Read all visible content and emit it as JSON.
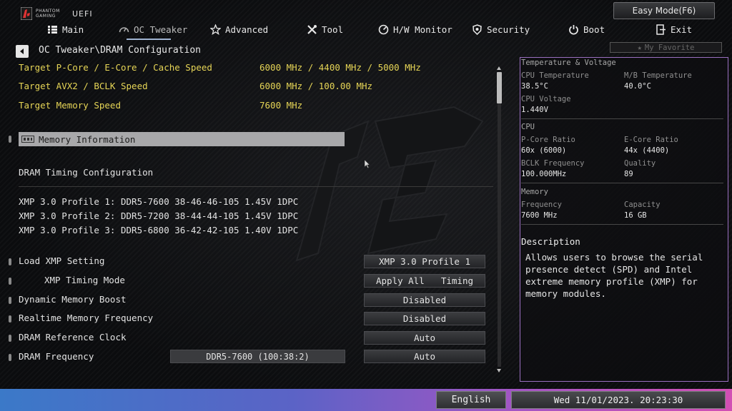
{
  "brand": {
    "line1": "PHANTOM",
    "line2": "GAMING",
    "uefi": "UEFI"
  },
  "header": {
    "easy_mode_label": "Easy Mode(F6)"
  },
  "nav": {
    "items": [
      {
        "label": "Main",
        "icon": "list-icon"
      },
      {
        "label": "OC Tweaker",
        "icon": "speedometer-icon"
      },
      {
        "label": "Advanced",
        "icon": "star-icon"
      },
      {
        "label": "Tool",
        "icon": "wrench-icon"
      },
      {
        "label": "H/W Monitor",
        "icon": "gauge-icon"
      },
      {
        "label": "Security",
        "icon": "shield-icon"
      },
      {
        "label": "Boot",
        "icon": "power-icon"
      },
      {
        "label": "Exit",
        "icon": "exit-icon"
      }
    ],
    "active": "OC Tweaker"
  },
  "breadcrumb": "OC Tweaker\\DRAM Configuration",
  "favorite_label": "My Favorite",
  "targets": [
    {
      "label": "Target P-Core / E-Core / Cache Speed",
      "value": "6000 MHz / 4400 MHz / 5000 MHz"
    },
    {
      "label": "Target AVX2 / BCLK Speed",
      "value": "6000 MHz / 100.00 MHz"
    },
    {
      "label": "Target Memory Speed",
      "value": "7600 MHz"
    }
  ],
  "memory_info_label": "Memory Information",
  "dram_timing_heading": "DRAM Timing Configuration",
  "xmp_profiles": [
    "XMP 3.0 Profile 1: DDR5-7600 38-46-46-105 1.45V 1DPC",
    "XMP 3.0 Profile 2: DDR5-7200 38-44-44-105 1.45V 1DPC",
    "XMP 3.0 Profile 3: DDR5-6800 36-42-42-105 1.40V 1DPC"
  ],
  "settings": {
    "load_xmp": {
      "label": "Load XMP Setting",
      "value": "XMP 3.0 Profile 1"
    },
    "xmp_timing_mode": {
      "label": "XMP Timing Mode",
      "value_left": "Apply All",
      "value_right": "Timing"
    },
    "dynamic_boost": {
      "label": "Dynamic Memory Boost",
      "value": "Disabled"
    },
    "realtime_freq": {
      "label": "Realtime Memory Frequency",
      "value": "Disabled"
    },
    "ref_clock": {
      "label": "DRAM Reference Clock",
      "value": "Auto"
    },
    "dram_freq": {
      "label": "DRAM Frequency",
      "current": "DDR5-7600 (100:38:2)",
      "value": "Auto"
    }
  },
  "panel": {
    "temp_title": "Temperature & Voltage",
    "cpu_temp_label": "CPU Temperature",
    "cpu_temp": "38.5°C",
    "mb_temp_label": "M/B Temperature",
    "mb_temp": "40.0°C",
    "cpu_volt_label": "CPU Voltage",
    "cpu_volt": "1.440V",
    "cpu_title": "CPU",
    "pcore_label": "P-Core Ratio",
    "pcore": "60x (6000)",
    "ecore_label": "E-Core Ratio",
    "ecore": "44x (4400)",
    "bclk_label": "BCLK Frequency",
    "bclk": "100.000MHz",
    "quality_label": "Quality",
    "quality": "89",
    "mem_title": "Memory",
    "freq_label": "Frequency",
    "freq": "7600 MHz",
    "cap_label": "Capacity",
    "cap": "16 GB",
    "desc_title": "Description",
    "desc_text": "Allows users to browse the serial\npresence detect (SPD) and Intel\nextreme memory profile (XMP) for\nmemory modules."
  },
  "footer": {
    "language": "English",
    "datetime": "Wed 11/01/2023. 20:23:30"
  },
  "colors": {
    "highlight_yellow": "#e6d556",
    "panel_border": "#9a6fc0",
    "footer_gradient_start": "#3b79c8",
    "footer_gradient_end": "#d24fb4"
  }
}
